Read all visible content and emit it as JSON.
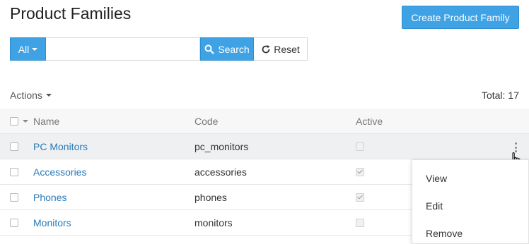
{
  "header": {
    "title": "Product Families",
    "create_label": "Create Product Family"
  },
  "filter": {
    "all_label": "All",
    "search_value": "",
    "search_label": "Search",
    "reset_label": "Reset"
  },
  "toolbar": {
    "actions_label": "Actions",
    "total_label": "Total:",
    "total_count": "17"
  },
  "grid": {
    "columns": [
      "Name",
      "Code",
      "Active"
    ],
    "rows": [
      {
        "name": "PC Monitors",
        "code": "pc_monitors",
        "active": false
      },
      {
        "name": "Accessories",
        "code": "accessories",
        "active": true
      },
      {
        "name": "Phones",
        "code": "phones",
        "active": true
      },
      {
        "name": "Monitors",
        "code": "monitors",
        "active": false
      }
    ]
  },
  "row_menu": {
    "items": [
      "View",
      "Edit",
      "Remove"
    ]
  },
  "colors": {
    "primary": "#3ea2e5",
    "link": "#2a7ab8",
    "hover_row": "#eef0f2"
  },
  "icons": [
    "caret-down-icon",
    "search-icon",
    "reset-icon",
    "kebab-icon",
    "hand-cursor-icon"
  ]
}
